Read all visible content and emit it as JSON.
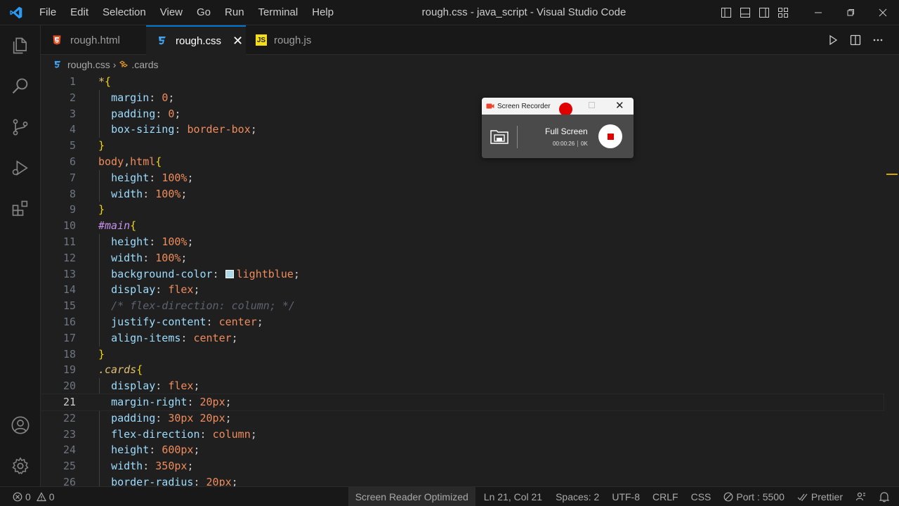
{
  "titlebar": {
    "menu": [
      "File",
      "Edit",
      "Selection",
      "View",
      "Go",
      "Run",
      "Terminal",
      "Help"
    ],
    "window_title": "rough.css - java_script - Visual Studio Code"
  },
  "tabs": [
    {
      "label": "rough.html",
      "icon": "html-file-icon",
      "icon_color": "#e44d26"
    },
    {
      "label": "rough.css",
      "icon": "css-file-icon",
      "icon_color": "#42a5f5",
      "active": true
    },
    {
      "label": "rough.js",
      "icon": "js-file-icon",
      "icon_color": "#f5de19",
      "icon_text": "JS"
    }
  ],
  "breadcrumb": {
    "file": "rough.css",
    "symbol": ".cards"
  },
  "editor": {
    "current_line": 21,
    "lines": [
      {
        "n": "1"
      },
      {
        "n": "2"
      },
      {
        "n": "3"
      },
      {
        "n": "4"
      },
      {
        "n": "5"
      },
      {
        "n": "6"
      },
      {
        "n": "7"
      },
      {
        "n": "8"
      },
      {
        "n": "9"
      },
      {
        "n": "10"
      },
      {
        "n": "11"
      },
      {
        "n": "12"
      },
      {
        "n": "13"
      },
      {
        "n": "14"
      },
      {
        "n": "15"
      },
      {
        "n": "16"
      },
      {
        "n": "17"
      },
      {
        "n": "18"
      },
      {
        "n": "19"
      },
      {
        "n": "20"
      },
      {
        "n": "21"
      },
      {
        "n": "22"
      },
      {
        "n": "23"
      },
      {
        "n": "24"
      },
      {
        "n": "25"
      },
      {
        "n": "26"
      }
    ],
    "tokens": {
      "l1": [
        "*",
        "{"
      ],
      "l2": [
        "margin",
        ": ",
        "0",
        ";"
      ],
      "l3": [
        "padding",
        ": ",
        "0",
        ";"
      ],
      "l4": [
        "box-sizing",
        ": ",
        "border-box",
        ";"
      ],
      "l5": [
        "}"
      ],
      "l6": [
        "body",
        ",",
        "html",
        "{"
      ],
      "l7": [
        "height",
        ": ",
        "100%",
        ";"
      ],
      "l8": [
        "width",
        ": ",
        "100%",
        ";"
      ],
      "l9": [
        "}"
      ],
      "l10": [
        "#main",
        "{"
      ],
      "l11": [
        "height",
        ": ",
        "100%",
        ";"
      ],
      "l12": [
        "width",
        ": ",
        "100%",
        ";"
      ],
      "l13": [
        "background-color",
        ": ",
        "lightblue",
        ";"
      ],
      "l14": [
        "display",
        ": ",
        "flex",
        ";"
      ],
      "l15": [
        "/* flex-direction: column; */"
      ],
      "l16": [
        "justify-content",
        ": ",
        "center",
        ";"
      ],
      "l17": [
        "align-items",
        ": ",
        "center",
        ";"
      ],
      "l18": [
        "}"
      ],
      "l19": [
        ".cards",
        "{"
      ],
      "l20": [
        "display",
        ": ",
        "flex",
        ";"
      ],
      "l21": [
        "margin-right",
        ": ",
        "20px",
        ";"
      ],
      "l22": [
        "padding",
        ": ",
        "30px 20px",
        ";"
      ],
      "l23": [
        "flex-direction",
        ": ",
        "column",
        ";"
      ],
      "l24": [
        "height",
        ": ",
        "600px",
        ";"
      ],
      "l25": [
        "width",
        ": ",
        "350px",
        ";"
      ],
      "l26": [
        "border-radius",
        ": ",
        "20px",
        ";"
      ]
    }
  },
  "statusbar": {
    "errors": "0",
    "warnings": "0",
    "screen_reader": "Screen Reader Optimized",
    "position": "Ln 21, Col 21",
    "spaces": "Spaces: 2",
    "encoding": "UTF-8",
    "eol": "CRLF",
    "language": "CSS",
    "port": "Port : 5500",
    "prettier": "Prettier"
  },
  "recorder": {
    "title": "Screen Recorder",
    "mode": "Full Screen",
    "time": "00:00:26",
    "size": "0K"
  },
  "colors": {
    "accent": "#0078d4",
    "swatch_lightblue": "#add8e6",
    "record_red": "#e00000"
  }
}
